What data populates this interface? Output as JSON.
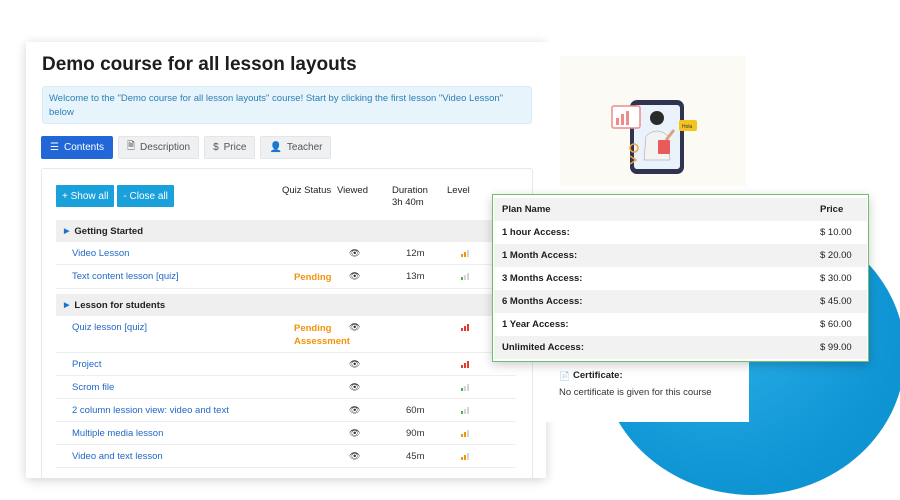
{
  "course": {
    "title": "Demo course for all lesson layouts",
    "welcome": "Welcome to the \"Demo course for all lesson layouts\" course! Start by clicking the first lesson \"Video Lesson\" below"
  },
  "tabs": [
    {
      "label": "Contents",
      "icon": "list-icon",
      "active": true
    },
    {
      "label": "Description",
      "icon": "document-icon"
    },
    {
      "label": "Price",
      "icon": "dollar-icon"
    },
    {
      "label": "Teacher",
      "icon": "user-icon"
    }
  ],
  "contents": {
    "show_all": "+ Show all",
    "close_all": "- Close all",
    "headers": {
      "quiz_status": "Quiz Status",
      "viewed": "Viewed",
      "duration": "Duration",
      "duration_total": "3h 40m",
      "level": "Level"
    },
    "sections": [
      {
        "title": "Getting Started"
      },
      {
        "title": "Lesson for students"
      }
    ],
    "lessons": [
      {
        "name": "Video Lesson",
        "status": "",
        "viewed": true,
        "duration": "12m",
        "level": "medium"
      },
      {
        "name": "Text content lesson [quiz]",
        "status": "Pending",
        "viewed": true,
        "duration": "13m",
        "level": "easy"
      },
      {
        "name": "Quiz lesson [quiz]",
        "status": "Pending",
        "status2": "Assessment",
        "viewed": true,
        "duration": "",
        "level": "hard"
      },
      {
        "name": "Project",
        "status": "",
        "viewed": true,
        "duration": "",
        "level": "hard"
      },
      {
        "name": "Scrom file",
        "status": "",
        "viewed": true,
        "duration": "",
        "level": "easy"
      },
      {
        "name": "2 column lession view: video and text",
        "status": "",
        "viewed": true,
        "duration": "60m",
        "level": "easy"
      },
      {
        "name": "Multiple media lesson",
        "status": "",
        "viewed": true,
        "duration": "90m",
        "level": "medium"
      },
      {
        "name": "Video and text lesson",
        "status": "",
        "viewed": true,
        "duration": "45m",
        "level": "medium"
      }
    ]
  },
  "pricing": {
    "header_plan": "Plan Name",
    "header_price": "Price",
    "plans": [
      {
        "name": "1 hour Access:",
        "price": "$ 10.00"
      },
      {
        "name": "1 Month Access:",
        "price": "$ 20.00"
      },
      {
        "name": "3 Months Access:",
        "price": "$ 30.00"
      },
      {
        "name": "6 Months Access:",
        "price": "$ 45.00"
      },
      {
        "name": "1 Year Access:",
        "price": "$ 60.00"
      },
      {
        "name": "Unlimited Access:",
        "price": "$ 99.00"
      }
    ]
  },
  "certificate": {
    "label": "Certificate:",
    "text": "No certificate is given for this course"
  },
  "illustration": {
    "bubble_text": "Hola"
  },
  "colors": {
    "primary": "#2167d8",
    "accent": "#1aa0db",
    "pending": "#f0950a",
    "link": "#2168c6",
    "easy": "#43b649",
    "medium": "#f0950a",
    "hard": "#e53935"
  }
}
